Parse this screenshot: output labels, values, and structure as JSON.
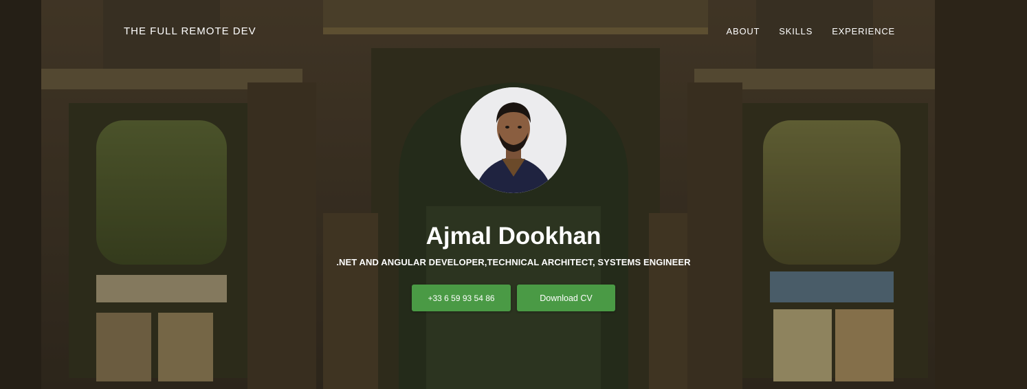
{
  "navbar": {
    "brand": "THE FULL REMOTE DEV",
    "links": [
      {
        "label": "ABOUT"
      },
      {
        "label": "SKILLS"
      },
      {
        "label": "EXPERIENCE"
      }
    ]
  },
  "hero": {
    "name": "Ajmal Dookhan",
    "subtitle": ".NET AND ANGULAR DEVELOPER,TECHNICAL ARCHITECT, SYSTEMS ENGINEER",
    "buttons": {
      "phone": "+33 6 59 93 54 86",
      "cv": "Download CV"
    }
  },
  "colors": {
    "button": "#4a9a45",
    "text": "#ffffff"
  }
}
